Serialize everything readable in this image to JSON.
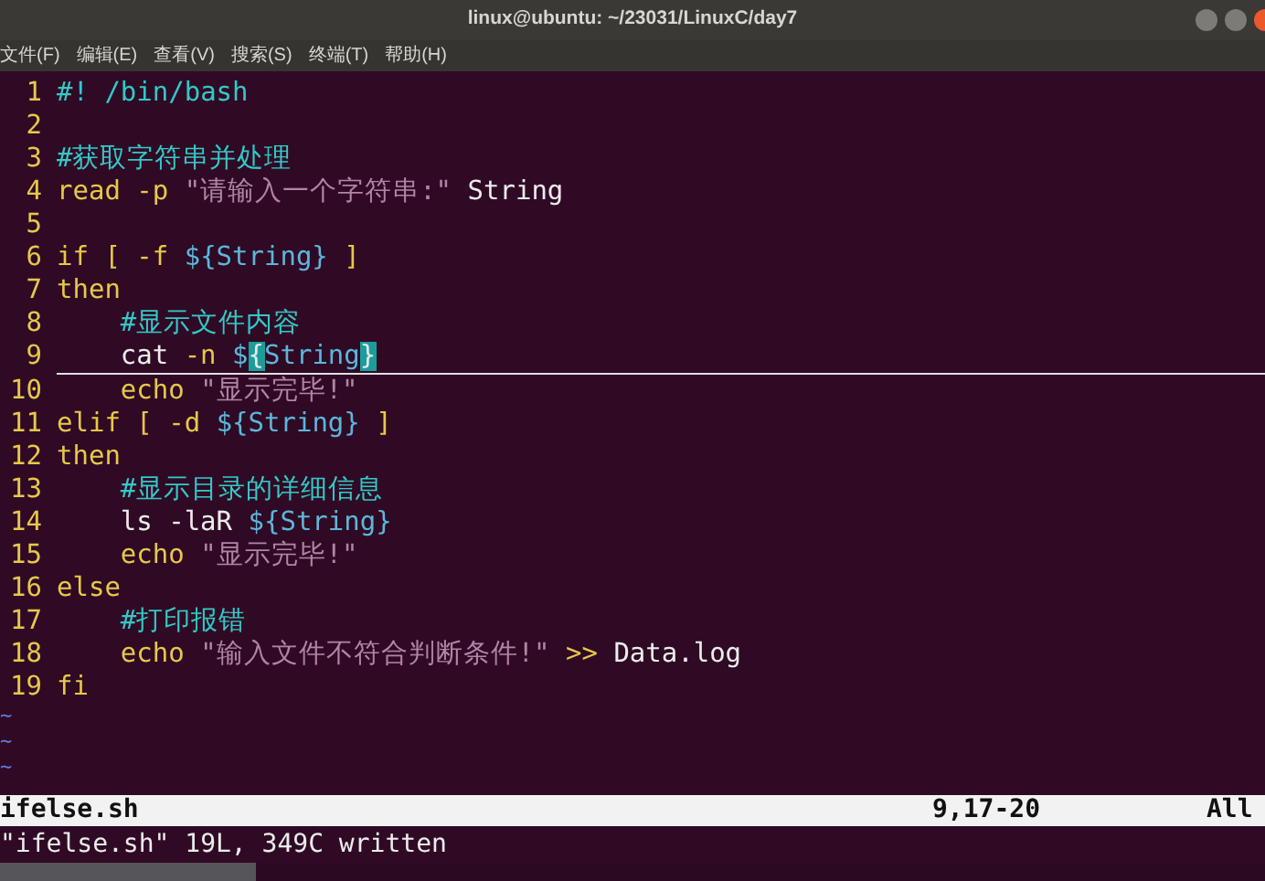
{
  "window": {
    "title": "linux@ubuntu: ~/23031/LinuxC/day7"
  },
  "menu": [
    "文件(F)",
    "编辑(E)",
    "查看(V)",
    "搜索(S)",
    "终端(T)",
    "帮助(H)"
  ],
  "editor": {
    "lines": [
      {
        "number": "1",
        "tokens": [
          {
            "text": "#! /bin/bash",
            "kind": "comment"
          }
        ]
      },
      {
        "number": "2"
      },
      {
        "number": "3",
        "tokens": [
          {
            "text": "#获取字符串并处理",
            "kind": "comment"
          }
        ]
      },
      {
        "number": "4",
        "tokens": [
          {
            "text": "read -p ",
            "kind": "keyword"
          },
          {
            "text": "\"请输入一个字符串:\"",
            "kind": "string"
          },
          {
            "text": " String",
            "kind": "plain"
          }
        ]
      },
      {
        "number": "5"
      },
      {
        "number": "6",
        "tokens": [
          {
            "text": "if [ -f ",
            "kind": "keyword"
          },
          {
            "text": "${String}",
            "kind": "variable"
          },
          {
            "text": " ]",
            "kind": "keyword"
          }
        ]
      },
      {
        "number": "7",
        "tokens": [
          {
            "text": "then",
            "kind": "keyword"
          }
        ]
      },
      {
        "number": "8",
        "indented": true,
        "tokens": [
          {
            "text": "#显示文件内容",
            "kind": "comment"
          }
        ]
      },
      {
        "number": "9",
        "indented": true,
        "cursor_line": true,
        "tokens": [
          {
            "text": "cat ",
            "kind": "plain"
          },
          {
            "text": "-n",
            "kind": "keyword"
          },
          {
            "text": " $",
            "kind": "variable"
          },
          {
            "text": "{",
            "kind": "match"
          },
          {
            "text": "String",
            "kind": "variable"
          },
          {
            "text": "}",
            "kind": "match"
          }
        ]
      },
      {
        "number": "10",
        "indented": true,
        "tokens": [
          {
            "text": "echo ",
            "kind": "keyword"
          },
          {
            "text": "\"显示完毕!\"",
            "kind": "string"
          }
        ]
      },
      {
        "number": "11",
        "tokens": [
          {
            "text": "elif [ -d ",
            "kind": "keyword"
          },
          {
            "text": "${String}",
            "kind": "variable"
          },
          {
            "text": " ]",
            "kind": "keyword"
          }
        ]
      },
      {
        "number": "12",
        "tokens": [
          {
            "text": "then",
            "kind": "keyword"
          }
        ]
      },
      {
        "number": "13",
        "indented": true,
        "tokens": [
          {
            "text": "#显示目录的详细信息",
            "kind": "comment"
          }
        ]
      },
      {
        "number": "14",
        "indented": true,
        "tokens": [
          {
            "text": "ls -laR ",
            "kind": "plain"
          },
          {
            "text": "${String}",
            "kind": "variable"
          }
        ]
      },
      {
        "number": "15",
        "indented": true,
        "tokens": [
          {
            "text": "echo ",
            "kind": "keyword"
          },
          {
            "text": "\"显示完毕!\"",
            "kind": "string"
          }
        ]
      },
      {
        "number": "16",
        "tokens": [
          {
            "text": "else",
            "kind": "keyword"
          }
        ]
      },
      {
        "number": "17",
        "indented": true,
        "tokens": [
          {
            "text": "#打印报错",
            "kind": "comment"
          }
        ]
      },
      {
        "number": "18",
        "indented": true,
        "tokens": [
          {
            "text": "echo ",
            "kind": "keyword"
          },
          {
            "text": "\"输入文件不符合判断条件!\"",
            "kind": "string"
          },
          {
            "text": " >> ",
            "kind": "keyword"
          },
          {
            "text": "Data.log",
            "kind": "plain"
          }
        ]
      },
      {
        "number": "19",
        "tokens": [
          {
            "text": "fi",
            "kind": "keyword"
          }
        ]
      }
    ],
    "empty_line_markers": [
      "~",
      "~",
      "~"
    ]
  },
  "status_line": {
    "file": "ifelse.sh",
    "position": "9,17-20",
    "scroll": "All"
  },
  "command_line": "\"ifelse.sh\" 19L, 349C written"
}
